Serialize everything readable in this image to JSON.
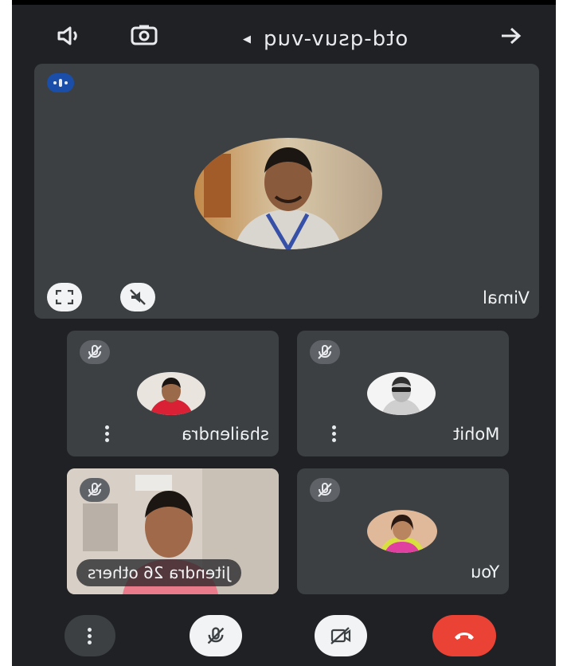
{
  "call": {
    "meeting_code": "otd-qsuv-vuq"
  },
  "main_tile": {
    "name": "Vimal",
    "speaking_icon": "speaking-indicator-icon",
    "pin_icon": "fullscreen-icon",
    "mute_icon": "mute-off-icon"
  },
  "participants": [
    {
      "name": "shailendra",
      "muted": true
    },
    {
      "name": "Mohit",
      "muted": true
    },
    {
      "name": "Jitendra",
      "muted": true,
      "others_label": "26 others"
    },
    {
      "name": "You",
      "muted": true
    }
  ],
  "colors": {
    "background": "#202124",
    "tile": "#3c4043",
    "end_call": "#ea4335",
    "speaking_badge": "#1a4ea8"
  }
}
